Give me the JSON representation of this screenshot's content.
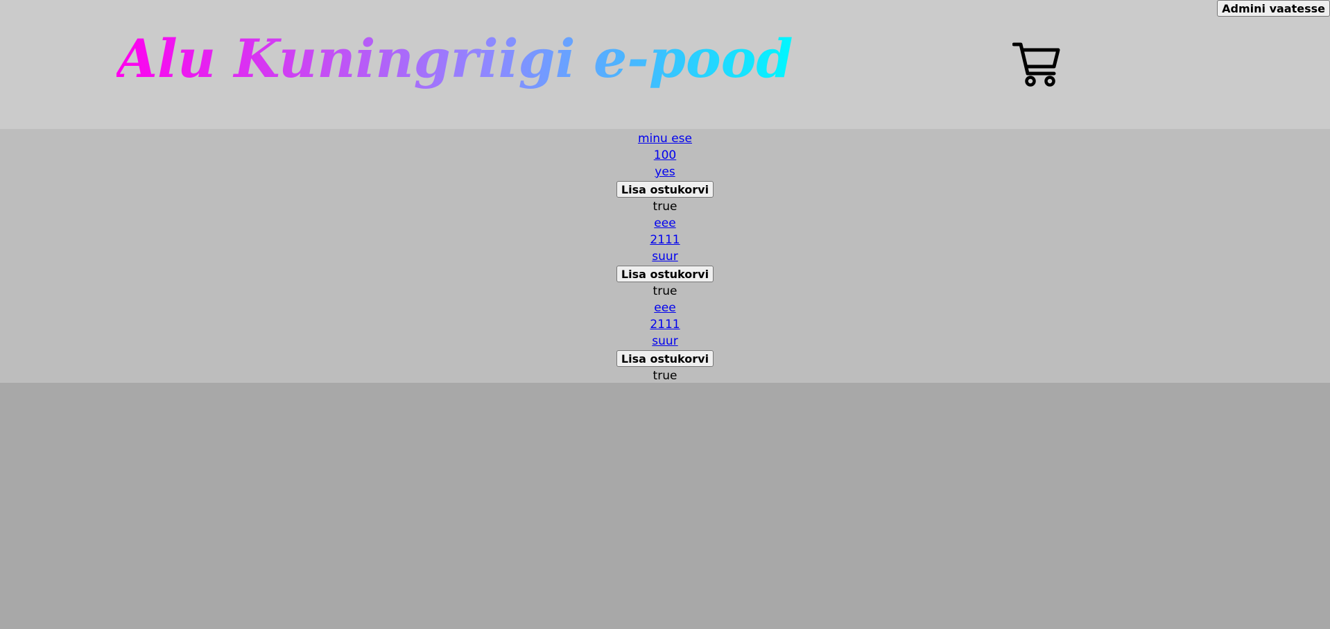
{
  "header": {
    "title": "Alu Kuningriigi e-pood",
    "admin_button": "Admini vaatesse",
    "cart_icon": "shopping-cart-icon"
  },
  "products": [
    {
      "name": "minu ese",
      "price": "100",
      "category": "yes",
      "add_button": "Lisa ostukorvi",
      "active": "true"
    },
    {
      "name": "eee",
      "price": "2111",
      "category": "suur",
      "add_button": "Lisa ostukorvi",
      "active": "true"
    },
    {
      "name": "eee",
      "price": "2111",
      "category": "suur",
      "add_button": "Lisa ostukorvi",
      "active": "true"
    }
  ]
}
